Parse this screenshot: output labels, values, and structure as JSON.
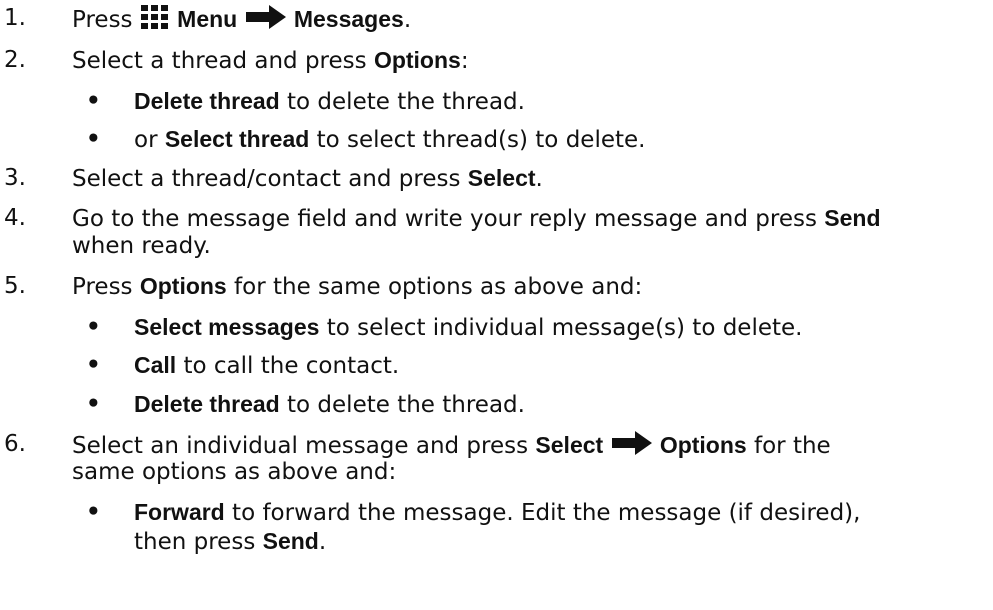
{
  "steps": [
    {
      "number": "1.",
      "prefix": "Press ",
      "menu_label": "Menu",
      "messages_label": "Messages",
      "end": "."
    },
    {
      "number": "2.",
      "text": "Select a thread and press ",
      "bold": "Options",
      "end": ":",
      "bullets": [
        {
          "bold": "Delete thread",
          "text": " to delete the thread."
        },
        {
          "prefix": "or ",
          "bold": "Select thread",
          "text": " to select thread(s) to delete."
        }
      ]
    },
    {
      "number": "3.",
      "text": "Select a thread/contact and press ",
      "bold": "Select",
      "end": "."
    },
    {
      "number": "4.",
      "text": "Go to the message field and write your reply message and press ",
      "bold": "Send",
      "line2": "when ready."
    },
    {
      "number": "5.",
      "prefix": "Press ",
      "bold": "Options",
      "text": " for the same options as above and:",
      "bullets": [
        {
          "bold": "Select messages",
          "text": " to select individual message(s) to delete."
        },
        {
          "bold": "Call",
          "text": " to call the contact."
        },
        {
          "bold": "Delete thread",
          "text": " to delete the thread."
        }
      ]
    },
    {
      "number": "6.",
      "text": "Select an individual message and press ",
      "bold": "Select",
      "bold2": "Options",
      "text2": " for the",
      "line2": "same options as above and:",
      "bullets": [
        {
          "bold": "Forward",
          "text": " to forward the message. Edit the message (if desired),",
          "line2_prefix": "then press ",
          "line2_bold": "Send",
          "line2_end": "."
        }
      ]
    }
  ],
  "bullet_char": "•",
  "icons": {
    "menu": "grid-menu-icon",
    "arrow": "right-arrow-icon"
  }
}
